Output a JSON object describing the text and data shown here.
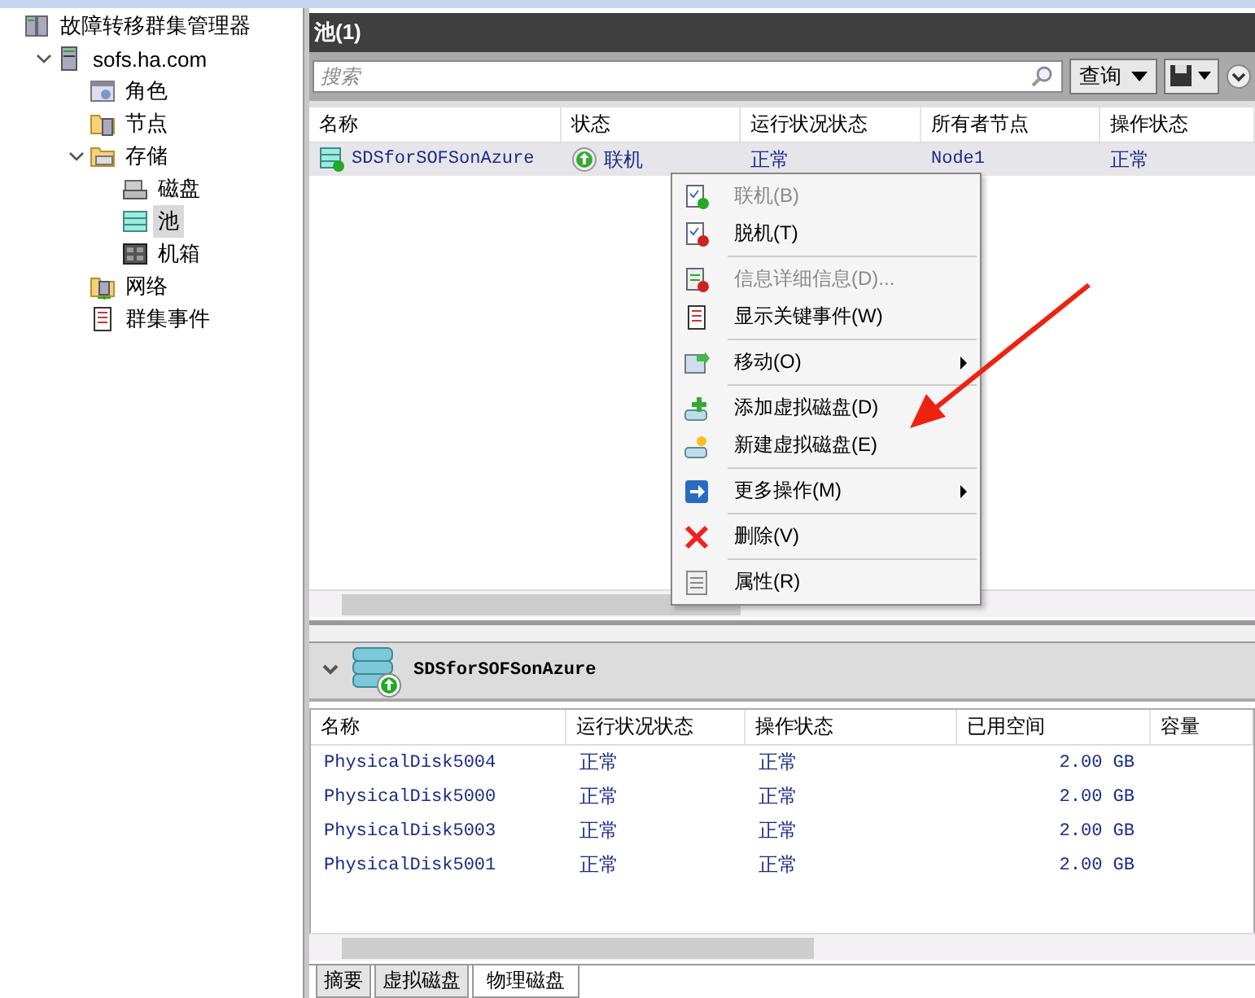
{
  "tree": [
    {
      "label": "故障转移群集管理器",
      "selected": false,
      "children": [
        {
          "label": "sofs.ha.com",
          "selected": false,
          "expanded": true,
          "children": [
            {
              "label": "角色",
              "selected": false
            },
            {
              "label": "节点",
              "selected": false
            },
            {
              "label": "存储",
              "selected": false,
              "expanded": true,
              "children": [
                {
                  "label": "磁盘",
                  "selected": false
                },
                {
                  "label": "池",
                  "selected": true
                },
                {
                  "label": "机箱",
                  "selected": false
                }
              ]
            },
            {
              "label": "网络",
              "selected": false
            },
            {
              "label": "群集事件",
              "selected": false
            }
          ]
        }
      ]
    }
  ],
  "pools": {
    "title": "池(1)",
    "search": {
      "placeholder": "搜索"
    },
    "query_button": "查询",
    "columns": [
      "名称",
      "状态",
      "运行状况状态",
      "所有者节点",
      "操作状态"
    ],
    "rows": [
      {
        "name": "SDSforSOFSonAzure",
        "status": "联机",
        "health": "正常",
        "owner": "Node1",
        "operational": "正常",
        "selected": true
      }
    ]
  },
  "context_menu": {
    "groups": [
      [
        {
          "label": "联机(B)",
          "disabled": true,
          "submenu": false
        },
        {
          "label": "脱机(T)",
          "disabled": false,
          "submenu": false
        }
      ],
      [
        {
          "label": "信息详细信息(D)...",
          "disabled": true,
          "submenu": false
        },
        {
          "label": "显示关键事件(W)",
          "disabled": false,
          "submenu": false
        }
      ],
      [
        {
          "label": "移动(O)",
          "disabled": false,
          "submenu": true
        }
      ],
      [
        {
          "label": "添加虚拟磁盘(D)",
          "disabled": false,
          "submenu": false
        },
        {
          "label": "新建虚拟磁盘(E)",
          "disabled": false,
          "submenu": false
        }
      ],
      [
        {
          "label": "更多操作(M)",
          "disabled": false,
          "submenu": true
        }
      ],
      [
        {
          "label": "删除(V)",
          "disabled": false,
          "submenu": false
        }
      ],
      [
        {
          "label": "属性(R)",
          "disabled": false,
          "submenu": false
        }
      ]
    ]
  },
  "detail": {
    "title": "SDSforSOFSonAzure",
    "columns": [
      "名称",
      "运行状况状态",
      "操作状态",
      "已用空间",
      "容量"
    ],
    "rows": [
      {
        "name": "PhysicalDisk5004",
        "health": "正常",
        "operational": "正常",
        "used": "2.00 GB"
      },
      {
        "name": "PhysicalDisk5000",
        "health": "正常",
        "operational": "正常",
        "used": "2.00 GB"
      },
      {
        "name": "PhysicalDisk5003",
        "health": "正常",
        "operational": "正常",
        "used": "2.00 GB"
      },
      {
        "name": "PhysicalDisk5001",
        "health": "正常",
        "operational": "正常",
        "used": "2.00 GB"
      }
    ],
    "tabs": [
      {
        "label": "摘要",
        "selected": false
      },
      {
        "label": "虚拟磁盘",
        "selected": false
      },
      {
        "label": "物理磁盘",
        "selected": true
      }
    ]
  }
}
